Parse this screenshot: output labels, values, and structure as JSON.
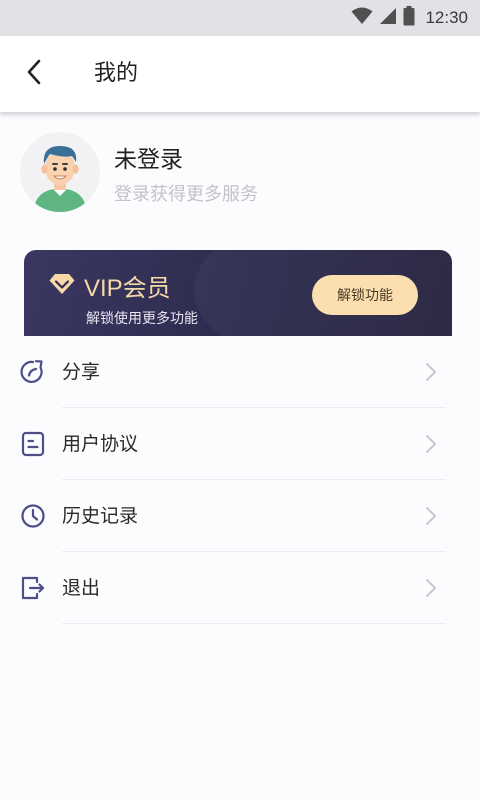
{
  "status_bar": {
    "time": "12:30",
    "icons": [
      "wifi-icon",
      "cellular-signal-icon",
      "battery-icon"
    ]
  },
  "app_bar": {
    "back_icon": "back-arrow-icon",
    "title": "我的"
  },
  "profile": {
    "username": "未登录",
    "hint": "登录获得更多服务",
    "avatar": "user-avatar-cartoon"
  },
  "vip": {
    "title": "VIP会员",
    "subtitle": "解锁使用更多功能",
    "button": "解锁功能",
    "icon": "diamond-icon",
    "colors": {
      "card": "#2c2a4c",
      "accent": "#f7d9a8",
      "button": "#fbdfb0"
    }
  },
  "menu": [
    {
      "label": "分享",
      "icon": "share-icon"
    },
    {
      "label": "用户协议",
      "icon": "agreement-icon"
    },
    {
      "label": "历史记录",
      "icon": "clock-icon"
    },
    {
      "label": "退出",
      "icon": "logout-icon"
    }
  ],
  "colors": {
    "icon": "#4b4f86",
    "background": "#fcfbfe"
  }
}
